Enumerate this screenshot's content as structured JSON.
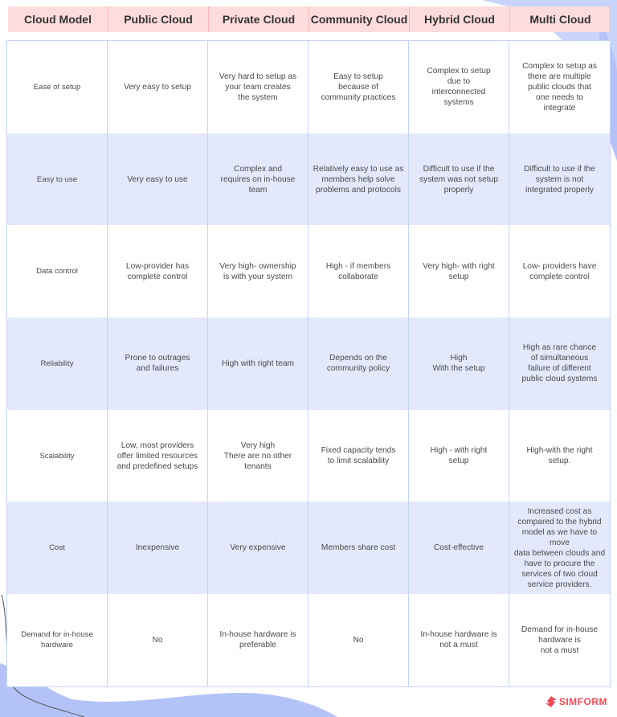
{
  "colors": {
    "header_bg": "#ffdcdc",
    "alt_row_bg": "#e3e9fb",
    "border": "#c7d2f7",
    "accent_blob": "#b3c2f7",
    "brand": "#ef4b56"
  },
  "table": {
    "headers": [
      "Cloud Model",
      "Public Cloud",
      "Private Cloud",
      "Community Cloud",
      "Hybrid Cloud",
      "Multi Cloud"
    ],
    "rows": [
      {
        "label": "Ease of setup",
        "cells": [
          "Very easy to setup",
          "Very hard to setup as\nyour team creates\nthe system",
          "Easy to setup\nbecause of\ncommunity practices",
          "Complex to setup\ndue to\ninterconnected\nsystems",
          "Complex to setup as\nthere are multiple\npublic clouds that\none needs to\nintegrate"
        ]
      },
      {
        "label": "Easy to use",
        "cells": [
          "Very easy to use",
          "Complex and\nrequires on in-house\nteam",
          "Relatively easy to use as\nmembers help solve\nproblems and protocols",
          "Difficult to use if the\nsystem was not setup\nproperly",
          "Difficult to use if the\nsystem is not\nintegrated properly"
        ]
      },
      {
        "label": "Data control",
        "cells": [
          "Low-provider has\ncomplete control",
          "Very high- ownership\nis with your system",
          "High - if members\ncollaborate",
          "Very high- with right\nsetup",
          "Low- providers have\ncomplete control"
        ]
      },
      {
        "label": "Reliability",
        "cells": [
          "Prone to outrages\nand failures",
          "High with right team",
          "Depends on the\ncommunity policy",
          "High\nWith the setup",
          "High as rare chance\nof simultaneous\nfailure of different\npublic cloud systems"
        ]
      },
      {
        "label": "Scalability",
        "cells": [
          "Low, most providers\noffer limited resources\nand predefined setups",
          "Very high\nThere are no other\ntenants",
          "Fixed capacity tends\nto limit scalability",
          "High - with right\nsetup",
          "High-with the right\nsetup."
        ]
      },
      {
        "label": "Cost",
        "cells": [
          "Inexpensive",
          "Very expensive",
          "Members share cost",
          "Cost-effective",
          "Increased cost as\ncompared to the hybrid\nmodel as we have to move\ndata between clouds and\nhave to procure the\nservices of two cloud\nservice providers."
        ]
      },
      {
        "label": "Demand for in-house\nhardware",
        "cells": [
          "No",
          "In-house hardware is\npreferable",
          "No",
          "In-house hardware is\nnot a must",
          "Demand for in-house\nhardware is\nnot a must"
        ]
      }
    ]
  },
  "logo": {
    "icon": "simform-logo-icon",
    "text": "SIMFORM"
  }
}
